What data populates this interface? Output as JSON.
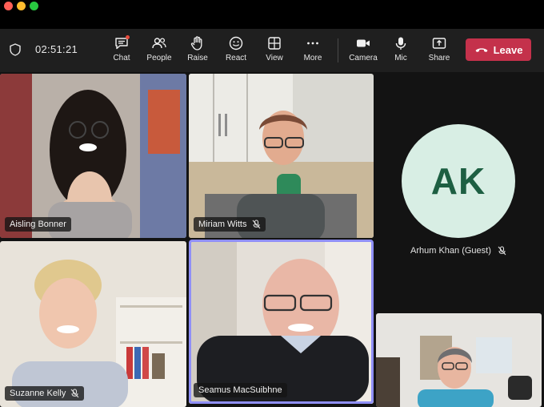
{
  "meeting": {
    "timer": "02:51:21"
  },
  "toolbar": {
    "chat": "Chat",
    "people": "People",
    "raise": "Raise",
    "react": "React",
    "view": "View",
    "more": "More",
    "camera": "Camera",
    "mic": "Mic",
    "share": "Share",
    "leave": "Leave"
  },
  "participants": [
    {
      "name": "Aisling Bonner",
      "muted": false
    },
    {
      "name": "Miriam Witts",
      "muted": true
    },
    {
      "name": "Arhum Khan (Guest)",
      "initials": "AK",
      "muted": true
    },
    {
      "name": "Suzanne Kelly",
      "muted": true
    },
    {
      "name": "Seamus MacSuibhne",
      "muted": false,
      "speaking": true
    },
    {
      "name": "",
      "muted": false
    }
  ],
  "colors": {
    "leave": "#c4314b",
    "speaking_outline": "#8f8ff7",
    "avatar_bg": "#d8eee4",
    "avatar_text": "#1d5f42",
    "chat_badge": "#e84c3d"
  },
  "icons": {
    "shield": "shield-icon",
    "chat": "chat-icon",
    "people": "people-icon",
    "raise": "raise-hand-icon",
    "react": "smiley-icon",
    "view": "grid-view-icon",
    "more": "more-icon",
    "camera": "camera-icon",
    "mic": "mic-icon",
    "share": "share-icon",
    "leave": "phone-hangup-icon",
    "muted": "mic-off-icon"
  }
}
